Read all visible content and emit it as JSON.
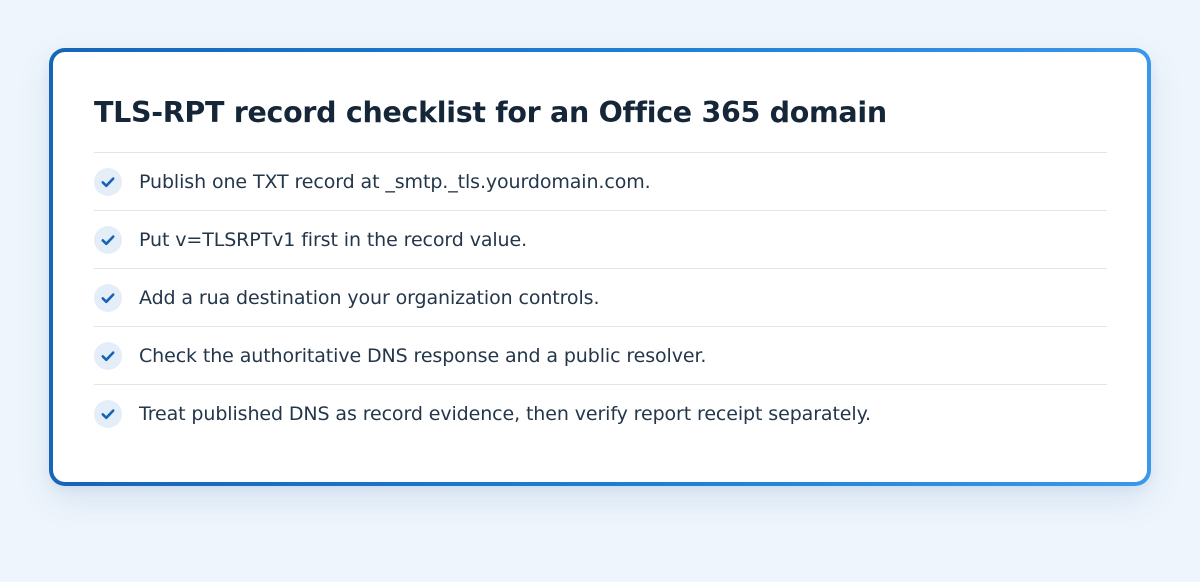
{
  "card": {
    "title": "TLS-RPT record checklist for an Office 365 domain",
    "items": [
      {
        "icon": "checkmark-icon",
        "text": "Publish one TXT record at _smtp._tls.yourdomain.com."
      },
      {
        "icon": "checkmark-icon",
        "text": "Put v=TLSRPTv1 first in the record value."
      },
      {
        "icon": "checkmark-icon",
        "text": "Add a rua destination your organization controls."
      },
      {
        "icon": "checkmark-icon",
        "text": "Check the authoritative DNS response and a public resolver."
      },
      {
        "icon": "checkmark-icon",
        "text": "Treat published DNS as record evidence, then verify report receipt separately."
      }
    ]
  },
  "colors": {
    "border_gradient_start": "#1565b8",
    "border_gradient_end": "#3a97ea",
    "check_color": "#1763b5",
    "check_bg": "#e4eef9",
    "title_color": "#152638",
    "text_color": "#24364a"
  }
}
